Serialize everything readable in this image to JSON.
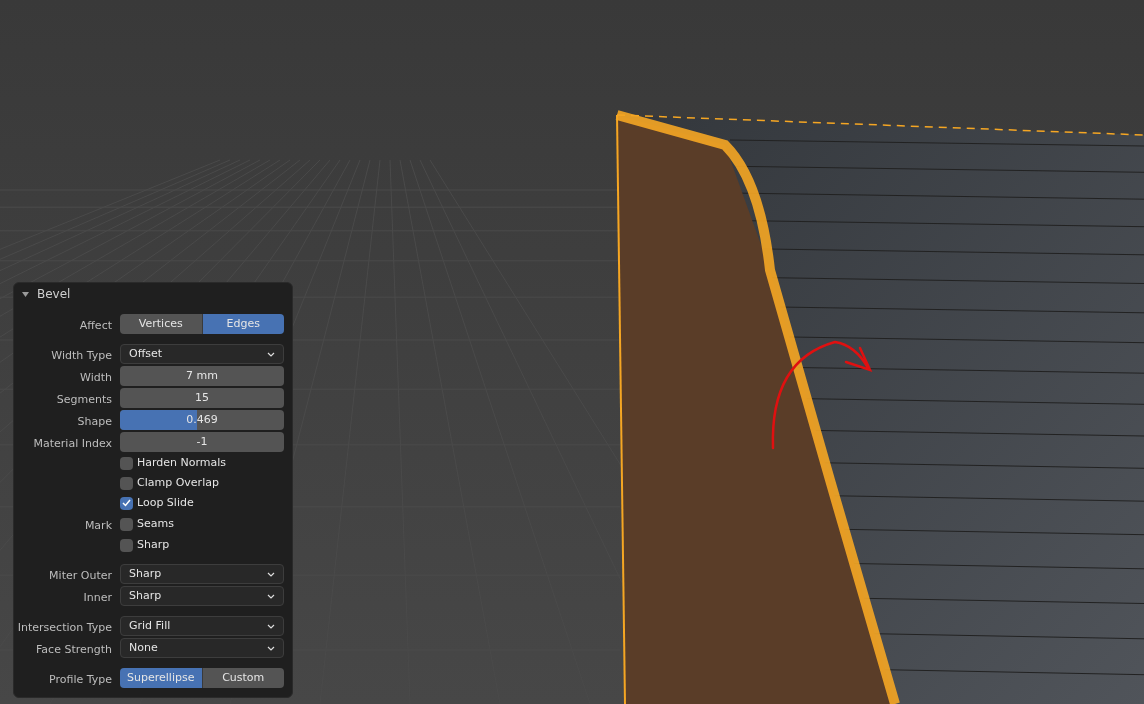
{
  "panel": {
    "title": "Bevel",
    "expanded": true,
    "groups": [
      [
        {
          "kind": "segmented",
          "label": "Affect",
          "options": [
            {
              "label": "Vertices",
              "selected": false
            },
            {
              "label": "Edges",
              "selected": true
            }
          ]
        }
      ],
      [
        {
          "kind": "dropdown",
          "label": "Width Type",
          "value": "Offset"
        },
        {
          "kind": "number",
          "label": "Width",
          "value": "7 mm"
        },
        {
          "kind": "number",
          "label": "Segments",
          "value": "15"
        },
        {
          "kind": "slider",
          "label": "Shape",
          "value": "0.469",
          "level": 0.469
        },
        {
          "kind": "number",
          "label": "Material Index",
          "value": "-1"
        },
        {
          "kind": "checkbox",
          "text": "Harden Normals",
          "checked": false
        },
        {
          "kind": "checkbox",
          "text": "Clamp Overlap",
          "checked": false
        },
        {
          "kind": "checkbox",
          "text": "Loop Slide",
          "checked": true
        },
        {
          "kind": "checkbox",
          "label": "Mark",
          "text": "Seams",
          "checked": false
        },
        {
          "kind": "checkbox",
          "text": "Sharp",
          "checked": false
        }
      ],
      [
        {
          "kind": "dropdown",
          "label": "Miter Outer",
          "value": "Sharp"
        },
        {
          "kind": "dropdown",
          "label": "Inner",
          "value": "Sharp"
        }
      ],
      [
        {
          "kind": "dropdown",
          "label": "Intersection Type",
          "value": "Grid Fill"
        },
        {
          "kind": "dropdown",
          "label": "Face Strength",
          "value": "None"
        }
      ],
      [
        {
          "kind": "segmented",
          "label": "Profile Type",
          "options": [
            {
              "label": "Superellipse",
              "selected": true
            },
            {
              "label": "Custom",
              "selected": false
            }
          ]
        }
      ]
    ]
  }
}
